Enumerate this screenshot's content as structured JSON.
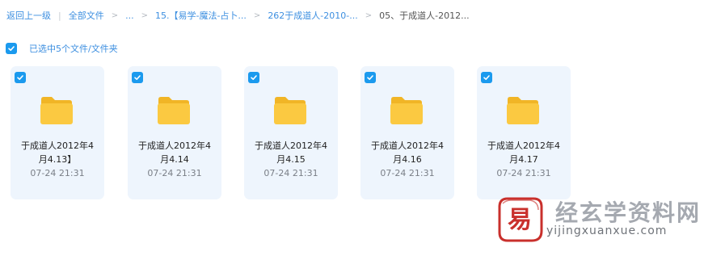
{
  "breadcrumb": {
    "back": "返回上一级",
    "all_files": "全部文件",
    "ellipsis": "...",
    "items": [
      "15.【易学-魔法-占卜...",
      "262于成道人-2010-...",
      "05、于成道人-2012..."
    ]
  },
  "selection": {
    "label": "已选中5个文件/文件夹",
    "checked": true
  },
  "files": [
    {
      "name_line1": "于成道人2012年4",
      "name_line2": "月4.13】",
      "date": "07-24 21:31",
      "type": "folder-icon"
    },
    {
      "name_line1": "于成道人2012年4",
      "name_line2": "月4.14",
      "date": "07-24 21:31",
      "type": "folder-icon"
    },
    {
      "name_line1": "于成道人2012年4",
      "name_line2": "月4.15",
      "date": "07-24 21:31",
      "type": "folder-icon"
    },
    {
      "name_line1": "于成道人2012年4",
      "name_line2": "月4.16",
      "date": "07-24 21:31",
      "type": "folder-icon"
    },
    {
      "name_line1": "于成道人2012年4",
      "name_line2": "月4.17",
      "date": "07-24 21:31",
      "type": "folder-icon"
    }
  ],
  "watermark": {
    "title": "经玄学资料网",
    "url": "yijingxuanxue.com",
    "logo_glyph": "易"
  },
  "colors": {
    "accent": "#1b9aee",
    "link": "#3d8fe0",
    "card_bg": "#eef5fd",
    "folder": "#fbc941",
    "logo_red": "#c9302c"
  }
}
